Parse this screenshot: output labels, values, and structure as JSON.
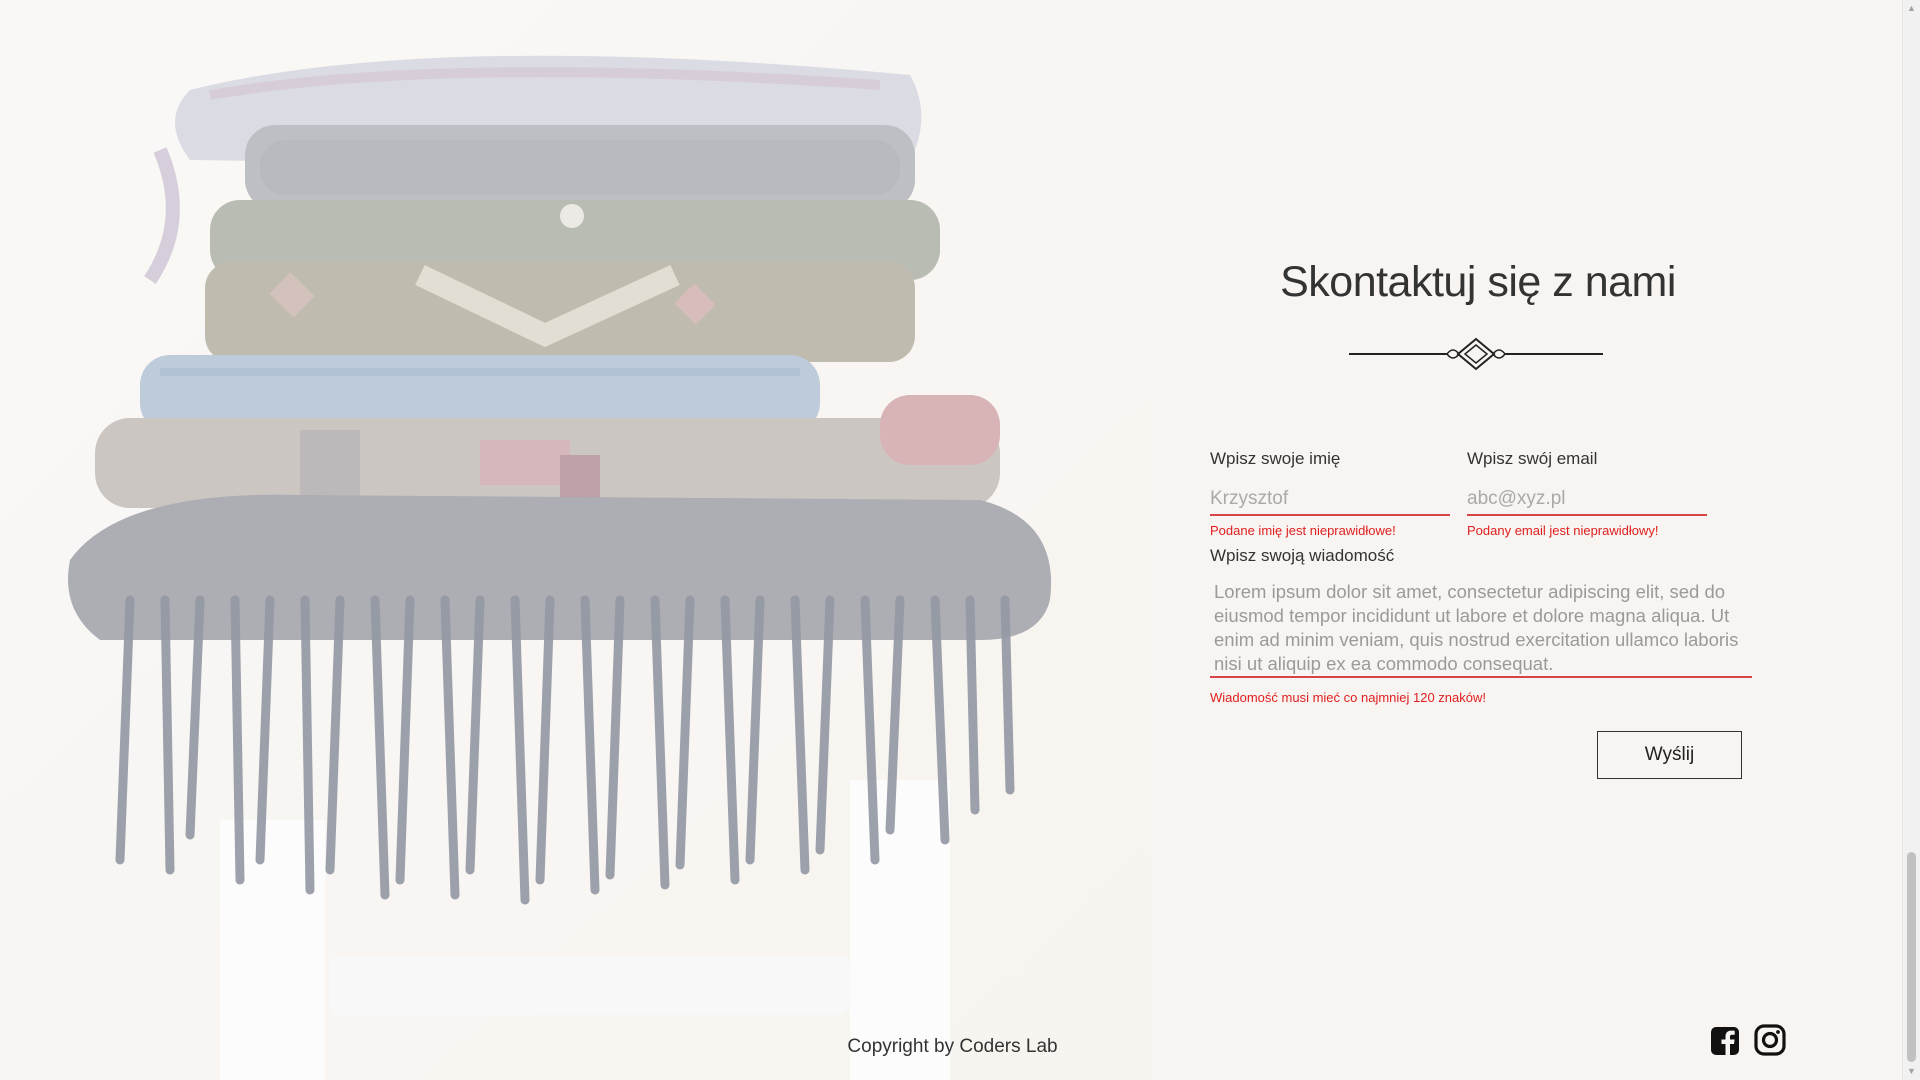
{
  "contact": {
    "title": "Skontaktuj się z nami",
    "name_label": "Wpisz swoje imię",
    "name_placeholder": "Krzysztof",
    "name_error": "Podane imię jest nieprawidłowe!",
    "email_label": "Wpisz swój email",
    "email_placeholder": "abc@xyz.pl",
    "email_error": "Podany email jest nieprawidłowy!",
    "message_label": "Wpisz swoją wiadomość",
    "message_value": "Lorem ipsum dolor sit amet, consectetur adipiscing elit, sed do eiusmod tempor incididunt ut labore et dolore magna aliqua. Ut enim ad minim veniam, quis nostrud exercitation ullamco laboris nisi ut aliquip ex ea commodo consequat.",
    "message_error": "Wiadomość musi mieć co najmniej 120 znaków!",
    "submit_label": "Wyślij"
  },
  "footer": {
    "copyright": "Copyright by Coders Lab",
    "social_icons": [
      "facebook-icon",
      "instagram-icon"
    ]
  },
  "colors": {
    "error": "#e02020",
    "input_underline": "#d64545",
    "text": "#333333"
  }
}
